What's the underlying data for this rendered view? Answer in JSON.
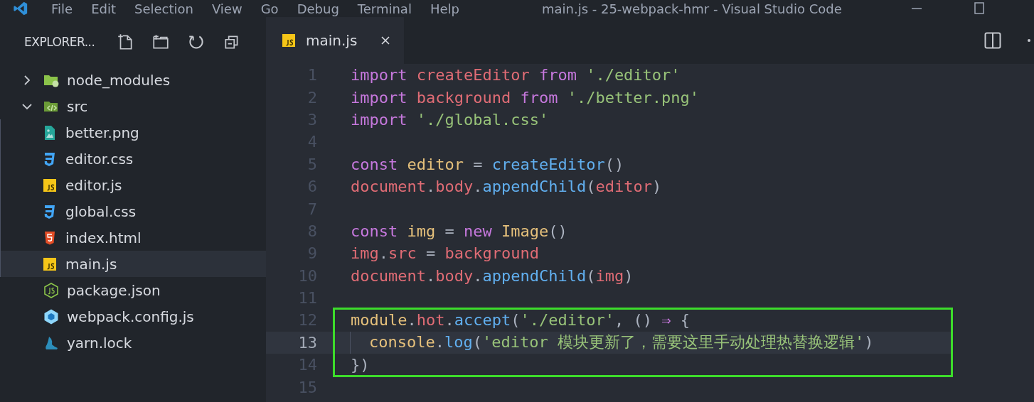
{
  "menu": [
    "File",
    "Edit",
    "Selection",
    "View",
    "Go",
    "Debug",
    "Terminal",
    "Help"
  ],
  "window": {
    "title": "main.js - 25-webpack-hmr - Visual Studio Code"
  },
  "explorer": {
    "title": "EXPLORER...",
    "items": [
      {
        "name": "node_modules",
        "kind": "folder",
        "expanded": false,
        "selected": false
      },
      {
        "name": "src",
        "kind": "srcfolder",
        "expanded": true,
        "selected": false,
        "children": [
          {
            "name": "better.png",
            "kind": "image",
            "selected": false
          },
          {
            "name": "editor.css",
            "kind": "css",
            "selected": false
          },
          {
            "name": "editor.js",
            "kind": "js",
            "selected": false
          },
          {
            "name": "global.css",
            "kind": "css",
            "selected": false
          },
          {
            "name": "index.html",
            "kind": "html",
            "selected": false
          },
          {
            "name": "main.js",
            "kind": "js",
            "selected": true
          }
        ]
      },
      {
        "name": "package.json",
        "kind": "node",
        "selected": false
      },
      {
        "name": "webpack.config.js",
        "kind": "webpack",
        "selected": false
      },
      {
        "name": "yarn.lock",
        "kind": "yarn",
        "selected": false
      }
    ]
  },
  "tabs": [
    {
      "label": "main.js",
      "kind": "js",
      "selected": true
    }
  ],
  "editor": {
    "lines": [
      {
        "number": "1",
        "current": false,
        "boxed": false,
        "tokens": [
          {
            "text": "import ",
            "kind": "keyword"
          },
          {
            "text": "createEditor ",
            "kind": "variable"
          },
          {
            "text": "from ",
            "kind": "keyword"
          },
          {
            "text": "'./editor'",
            "kind": "string"
          }
        ]
      },
      {
        "number": "2",
        "current": false,
        "boxed": false,
        "tokens": [
          {
            "text": "import ",
            "kind": "keyword"
          },
          {
            "text": "background ",
            "kind": "variable"
          },
          {
            "text": "from ",
            "kind": "keyword"
          },
          {
            "text": "'./better.png'",
            "kind": "string"
          }
        ]
      },
      {
        "number": "3",
        "current": false,
        "boxed": false,
        "tokens": [
          {
            "text": "import ",
            "kind": "keyword"
          },
          {
            "text": "'./global.css'",
            "kind": "string"
          }
        ]
      },
      {
        "number": "4",
        "current": false,
        "boxed": false
      },
      {
        "number": "5",
        "current": false,
        "boxed": false,
        "tokens": [
          {
            "text": "const ",
            "kind": "keyword"
          },
          {
            "text": "editor ",
            "kind": "constant"
          },
          {
            "text": "= ",
            "kind": "punctuation"
          },
          {
            "text": "createEditor",
            "kind": "function"
          },
          {
            "text": "()",
            "kind": "punctuation"
          }
        ]
      },
      {
        "number": "6",
        "current": false,
        "boxed": false,
        "tokens": [
          {
            "text": "document",
            "kind": "variable"
          },
          {
            "text": ".",
            "kind": "punctuation"
          },
          {
            "text": "body",
            "kind": "variable"
          },
          {
            "text": ".",
            "kind": "punctuation"
          },
          {
            "text": "appendChild",
            "kind": "function"
          },
          {
            "text": "(",
            "kind": "punctuation"
          },
          {
            "text": "editor",
            "kind": "variable"
          },
          {
            "text": ")",
            "kind": "punctuation"
          }
        ]
      },
      {
        "number": "7",
        "current": false,
        "boxed": false
      },
      {
        "number": "8",
        "current": false,
        "boxed": false,
        "tokens": [
          {
            "text": "const ",
            "kind": "keyword"
          },
          {
            "text": "img ",
            "kind": "constant"
          },
          {
            "text": "= ",
            "kind": "punctuation"
          },
          {
            "text": "new ",
            "kind": "keyword"
          },
          {
            "text": "Image",
            "kind": "constant"
          },
          {
            "text": "()",
            "kind": "punctuation"
          }
        ]
      },
      {
        "number": "9",
        "current": false,
        "boxed": false,
        "tokens": [
          {
            "text": "img",
            "kind": "variable"
          },
          {
            "text": ".",
            "kind": "punctuation"
          },
          {
            "text": "src ",
            "kind": "variable"
          },
          {
            "text": "= ",
            "kind": "punctuation"
          },
          {
            "text": "background",
            "kind": "variable"
          }
        ]
      },
      {
        "number": "10",
        "current": false,
        "boxed": false,
        "tokens": [
          {
            "text": "document",
            "kind": "variable"
          },
          {
            "text": ".",
            "kind": "punctuation"
          },
          {
            "text": "body",
            "kind": "variable"
          },
          {
            "text": ".",
            "kind": "punctuation"
          },
          {
            "text": "appendChild",
            "kind": "function"
          },
          {
            "text": "(",
            "kind": "punctuation"
          },
          {
            "text": "img",
            "kind": "variable"
          },
          {
            "text": ")",
            "kind": "punctuation"
          }
        ]
      },
      {
        "number": "11",
        "current": false,
        "boxed": false
      },
      {
        "number": "12",
        "current": false,
        "boxed": true,
        "tokens": [
          {
            "text": "module",
            "kind": "constant"
          },
          {
            "text": ".",
            "kind": "punctuation"
          },
          {
            "text": "hot",
            "kind": "variable"
          },
          {
            "text": ".",
            "kind": "punctuation"
          },
          {
            "text": "accept",
            "kind": "function"
          },
          {
            "text": "(",
            "kind": "punctuation"
          },
          {
            "text": "'./editor'",
            "kind": "string"
          },
          {
            "text": ", () ",
            "kind": "punctuation"
          },
          {
            "text": "⇒ ",
            "kind": "keyword"
          },
          {
            "text": "{",
            "kind": "punctuation"
          }
        ]
      },
      {
        "number": "13",
        "current": true,
        "boxed": true,
        "indent": true,
        "tokens": [
          {
            "text": "console",
            "kind": "constant"
          },
          {
            "text": ".",
            "kind": "punctuation"
          },
          {
            "text": "log",
            "kind": "function"
          },
          {
            "text": "(",
            "kind": "punctuation"
          },
          {
            "text": "'editor 模块更新了，需要这里手动处理热替换逻辑'",
            "kind": "string"
          },
          {
            "text": ")",
            "kind": "punctuation"
          }
        ]
      },
      {
        "number": "14",
        "current": false,
        "boxed": true,
        "tokens": [
          {
            "text": "})",
            "kind": "punctuation"
          }
        ]
      },
      {
        "number": "15",
        "current": false,
        "boxed": false
      }
    ]
  }
}
